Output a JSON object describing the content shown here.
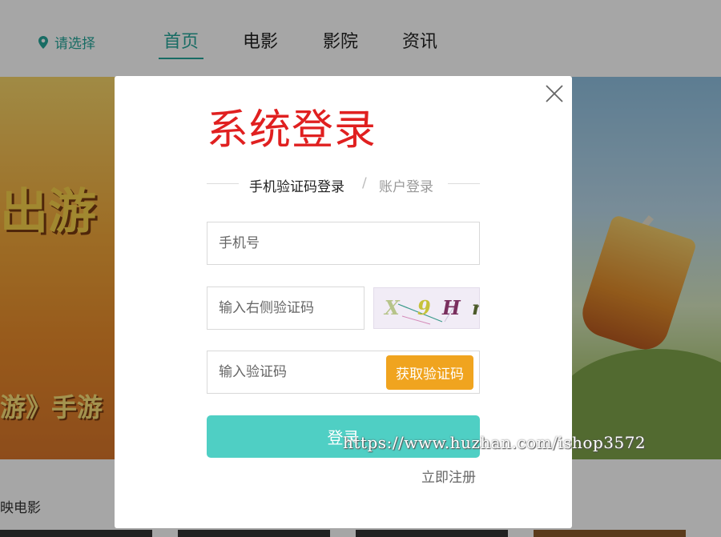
{
  "nav": {
    "location_label": "请选择",
    "items": [
      {
        "label": "首页"
      },
      {
        "label": "电影"
      },
      {
        "label": "影院"
      },
      {
        "label": "资讯"
      }
    ],
    "accent_color": "#26a69a"
  },
  "banner": {
    "game_text": "出游",
    "game_title_bottom": "游》手游"
  },
  "section": {
    "title": "映电影"
  },
  "modal": {
    "title": "系统登录",
    "title_color": "#e02020",
    "tabs": {
      "phone_login": "手机验证码登录",
      "separator": "/",
      "account_login": "账户登录"
    },
    "phone_placeholder": "手机号",
    "captcha_placeholder": "输入右侧验证码",
    "captcha_chars": [
      "X",
      "9",
      "H",
      "r"
    ],
    "sms_placeholder": "输入验证码",
    "sms_button": "获取验证码",
    "sms_button_color": "#f0a41f",
    "login_button": "登录",
    "login_button_color": "#4fcfc4",
    "register_link": "立即注册"
  },
  "watermark": "https://www.huzhan.com/ishop3572"
}
